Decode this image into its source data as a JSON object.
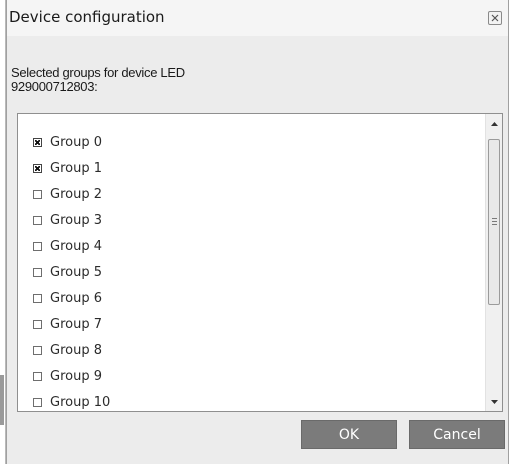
{
  "dialog": {
    "title": "Device configuration",
    "close_icon": "close-icon",
    "prompt_line1": "Selected groups for device LED",
    "prompt_line2": "929000712803:"
  },
  "groups": [
    {
      "label": "Group 0",
      "checked": true
    },
    {
      "label": "Group 1",
      "checked": true
    },
    {
      "label": "Group 2",
      "checked": false
    },
    {
      "label": "Group 3",
      "checked": false
    },
    {
      "label": "Group 4",
      "checked": false
    },
    {
      "label": "Group 5",
      "checked": false
    },
    {
      "label": "Group 6",
      "checked": false
    },
    {
      "label": "Group 7",
      "checked": false
    },
    {
      "label": "Group 8",
      "checked": false
    },
    {
      "label": "Group 9",
      "checked": false
    },
    {
      "label": "Group 10",
      "checked": false
    }
  ],
  "buttons": {
    "ok_label": "OK",
    "cancel_label": "Cancel"
  },
  "colors": {
    "button_bg": "#7b7b7b",
    "dialog_bg": "#ececec"
  }
}
